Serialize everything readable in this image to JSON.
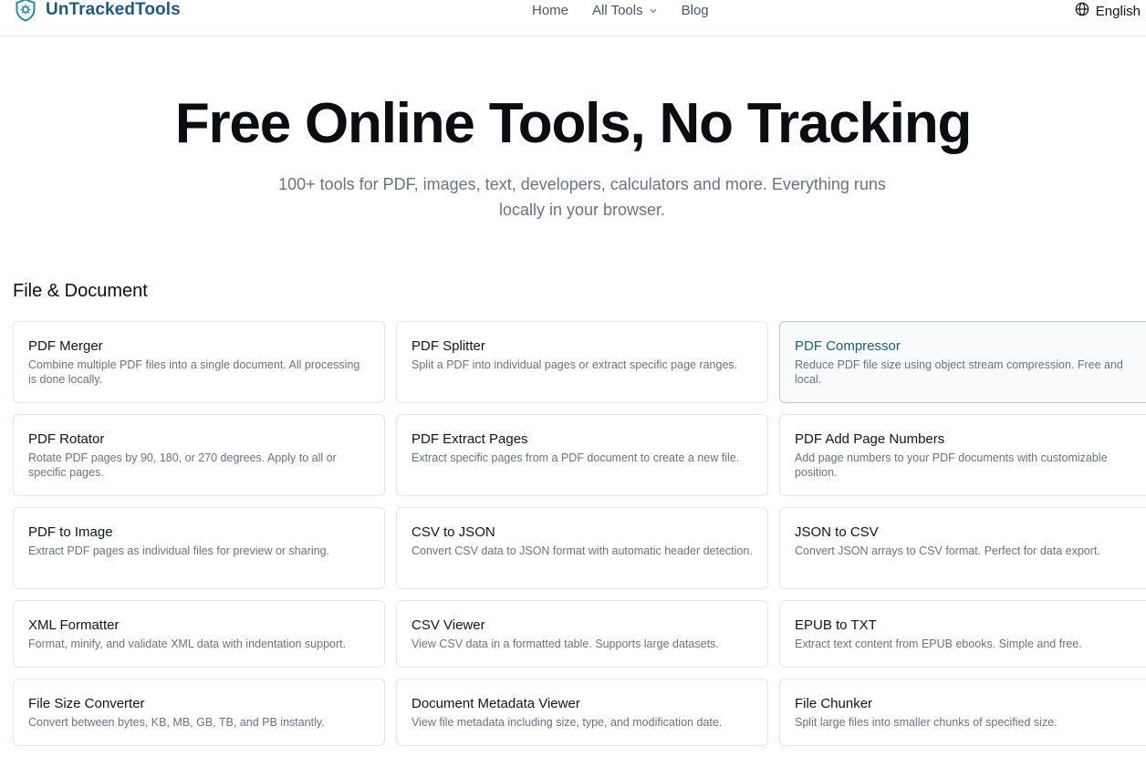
{
  "header": {
    "brand": "UnTrackedTools",
    "nav": {
      "home": "Home",
      "all_tools": "All Tools",
      "blog": "Blog"
    },
    "language": "English",
    "colors": {
      "brand": "#1f5b75",
      "border": "#e5e7eb"
    }
  },
  "hero": {
    "title": "Free Online Tools, No Tracking",
    "subtitle": "100+ tools for PDF, images, text, developers, calculators and more. Everything runs locally in your browser."
  },
  "section": {
    "title": "File & Document",
    "cards": [
      {
        "title": "PDF Merger",
        "desc": "Combine multiple PDF files into a single document. All processing is done locally."
      },
      {
        "title": "PDF Splitter",
        "desc": "Split a PDF into individual pages or extract specific page ranges."
      },
      {
        "title": "PDF Compressor",
        "desc": "Reduce PDF file size using object stream compression. Free and local."
      },
      {
        "title": "PDF Rotator",
        "desc": "Rotate PDF pages by 90, 180, or 270 degrees. Apply to all or specific pages."
      },
      {
        "title": "PDF Extract Pages",
        "desc": "Extract specific pages from a PDF document to create a new file."
      },
      {
        "title": "PDF Add Page Numbers",
        "desc": "Add page numbers to your PDF documents with customizable position."
      },
      {
        "title": "PDF to Image",
        "desc": "Extract PDF pages as individual files for preview or sharing."
      },
      {
        "title": "CSV to JSON",
        "desc": "Convert CSV data to JSON format with automatic header detection."
      },
      {
        "title": "JSON to CSV",
        "desc": "Convert JSON arrays to CSV format. Perfect for data export."
      },
      {
        "title": "XML Formatter",
        "desc": "Format, minify, and validate XML data with indentation support."
      },
      {
        "title": "CSV Viewer",
        "desc": "View CSV data in a formatted table. Supports large datasets."
      },
      {
        "title": "EPUB to TXT",
        "desc": "Extract text content from EPUB ebooks. Simple and free."
      },
      {
        "title": "File Size Converter",
        "desc": "Convert between bytes, KB, MB, GB, TB, and PB instantly."
      },
      {
        "title": "Document Metadata Viewer",
        "desc": "View file metadata including size, type, and modification date."
      },
      {
        "title": "File Chunker",
        "desc": "Split large files into smaller chunks of specified size."
      }
    ]
  }
}
